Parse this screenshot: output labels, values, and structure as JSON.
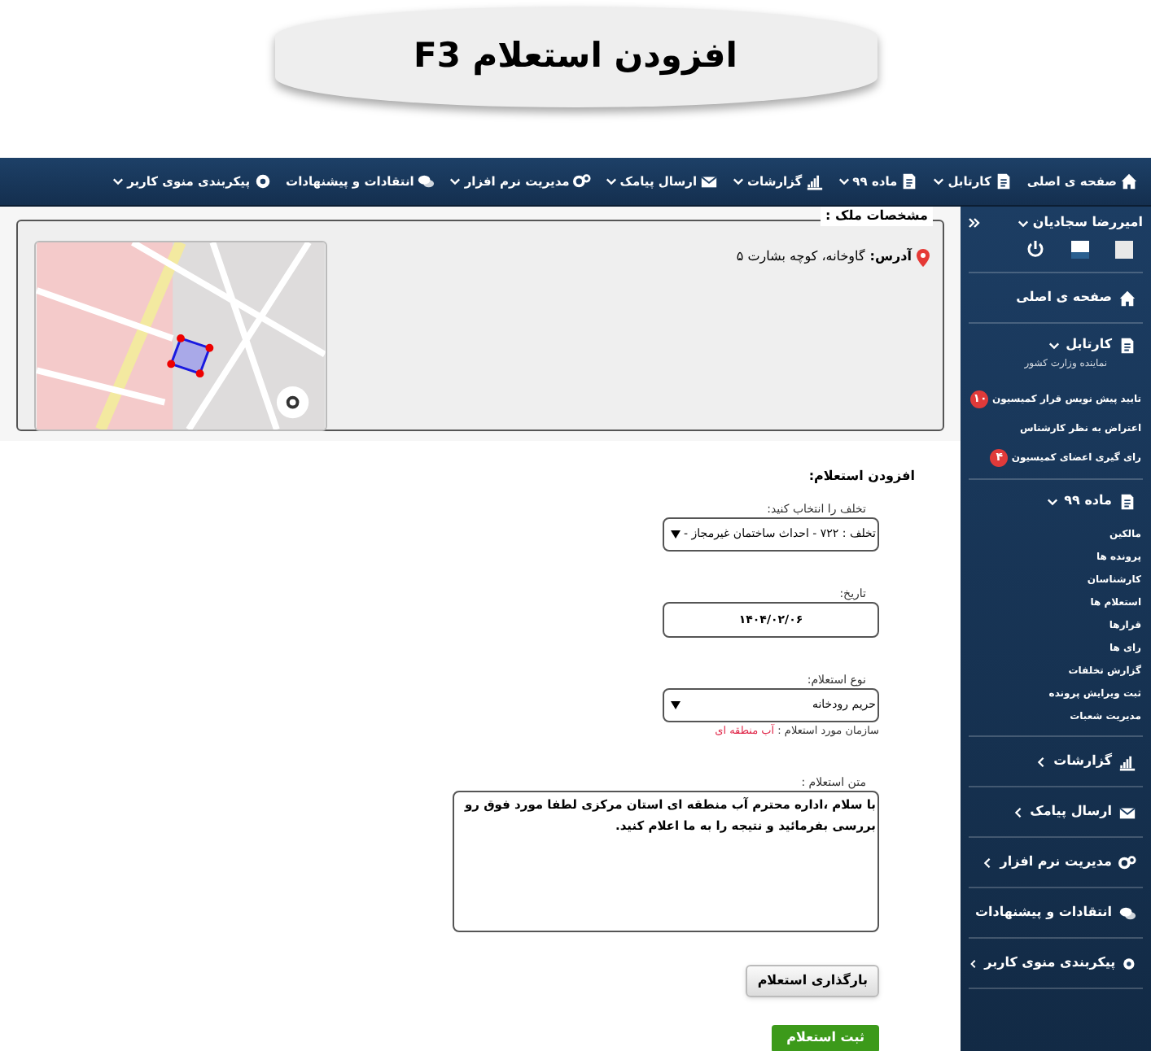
{
  "banner": {
    "title": "افزودن استعلام F3"
  },
  "top_nav": [
    {
      "label": "صفحه ی اصلی",
      "kind": "link"
    },
    {
      "label": "کارتابل",
      "kind": "menu"
    },
    {
      "label": "ماده ۹۹",
      "kind": "menu"
    },
    {
      "label": "گزارشات",
      "kind": "menu"
    },
    {
      "label": "ارسال پیامک",
      "kind": "menu"
    },
    {
      "label": "مدیریت نرم افزار",
      "kind": "menu"
    },
    {
      "label": "انتقادات و پیشنهادات",
      "kind": "link"
    },
    {
      "label": "پیکربندی منوی کاربر",
      "kind": "menu"
    }
  ],
  "sidebar": {
    "user": "امیررضا سجادیان",
    "items": [
      {
        "label": "صفحه ی اصلی",
        "kind": "link"
      },
      {
        "label": "کارتابل",
        "kind": "menu",
        "expanded": true,
        "subtitle": "نماینده وزارت کشور",
        "children": [
          {
            "label": "تایید پیش نویس قرار کمیسیون",
            "badge": "۱۰"
          },
          {
            "label": "اعتراض به نظر کارشناس"
          },
          {
            "label": "رای گیری اعضای کمیسیون",
            "badge": "۴"
          }
        ]
      },
      {
        "label": "ماده ۹۹",
        "kind": "menu",
        "expanded": true,
        "children": [
          {
            "label": "مالکین"
          },
          {
            "label": "پرونده ها"
          },
          {
            "label": "کارشناسان"
          },
          {
            "label": "استعلام ها"
          },
          {
            "label": "قرارها"
          },
          {
            "label": "رای ها"
          },
          {
            "label": "گزارش تخلفات"
          },
          {
            "label": "ثبت ویرایش پرونده"
          },
          {
            "label": "مدیریت شعبات"
          }
        ]
      },
      {
        "label": "گزارشات",
        "kind": "menu",
        "expanded": false
      },
      {
        "label": "ارسال پیامک",
        "kind": "menu",
        "expanded": false
      },
      {
        "label": "مدیریت نرم افزار",
        "kind": "menu",
        "expanded": false
      },
      {
        "label": "انتقادات و پیشنهادات",
        "kind": "link"
      },
      {
        "label": "پیکربندی منوی کاربر",
        "kind": "menu",
        "expanded": false
      }
    ]
  },
  "property": {
    "legend": "مشخصات ملک :",
    "address_label": "آدرس:",
    "address": "گاوخانه، کوچه بشارت ۵"
  },
  "form": {
    "heading": "افزودن استعلام:",
    "fields": [
      {
        "kind": "select",
        "legend": "تخلف را انتخاب کنید:",
        "value": "تخلف : ۷۲۲ - احداث ساختمان غیرمجاز -"
      },
      {
        "kind": "date",
        "legend": "تاریخ:",
        "value": "۱۴۰۴/۰۲/۰۶"
      },
      {
        "kind": "select",
        "legend": "نوع استعلام:",
        "value": "حریم رودخانه",
        "note_label": "سازمان مورد استعلام : ",
        "note_value": "آب منطقه ای"
      },
      {
        "kind": "textarea",
        "legend": "متن استعلام :",
        "value": "با سلام ،اداره محترم آب منطقه ای استان مرکزی لطفا مورد فوق رو بررسی بفرمائید و نتیجه را به ما اعلام کنید."
      }
    ],
    "upload_button": "بارگذاری استعلام",
    "submit_button": "ثبت استعلام"
  }
}
